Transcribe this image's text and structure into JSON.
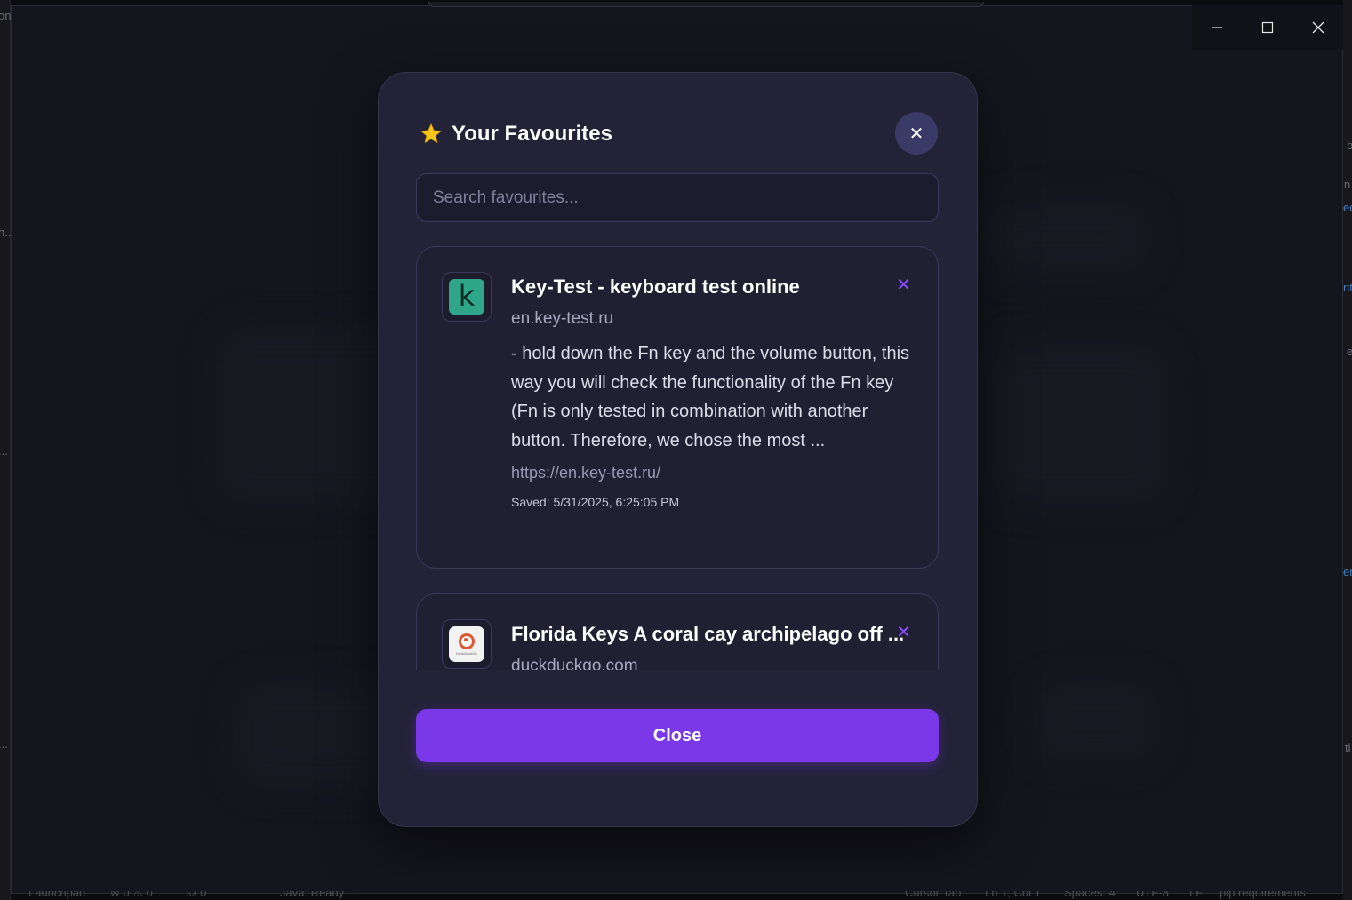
{
  "background": {
    "left_fragments": [
      "on",
      "n...",
      "...",
      "..."
    ],
    "right_fragments": [
      "b",
      "n",
      "eo",
      "nt",
      "e",
      "er",
      "ti"
    ],
    "status_bar": [
      "Launchpad",
      "⊗ 0 ⚠ 0",
      "☊ 0",
      "Java: Ready",
      "Cursor Tab",
      "Ln 1, Col 1",
      "Spaces: 4",
      "UTF-8",
      "LF",
      "pip requirements"
    ]
  },
  "window_controls": {
    "minimize_icon": "minimize-icon",
    "maximize_icon": "maximize-icon",
    "close_icon": "close-icon"
  },
  "modal": {
    "title": "Your Favourites",
    "title_icon": "star-icon",
    "close_x": "✕",
    "search": {
      "placeholder": "Search favourites...",
      "value": ""
    },
    "favourites": [
      {
        "title": "Key-Test - keyboard test online",
        "domain": "en.key-test.ru",
        "description": "- hold down the Fn key and the volume button, this way you will check the functionality of the Fn key (Fn is only tested in combination with another button. Therefore, we chose the most ...",
        "url": "https://en.key-test.ru/",
        "saved": "Saved: 5/31/2025, 6:25:05 PM",
        "favicon": "key-test-favicon",
        "favicon_letter": "k",
        "remove": "✕"
      },
      {
        "title": "Florida Keys A coral cay archipelago off ...",
        "domain": "duckduckgo.com",
        "favicon": "duckduckgo-favicon",
        "favicon_caption": "DuckDuckGo",
        "remove": "✕"
      }
    ],
    "close_button": "Close"
  },
  "colors": {
    "accent": "#7a38e8",
    "remove_x": "#8a4dff",
    "modal_bg": "#232237",
    "star": "#f5c518"
  }
}
